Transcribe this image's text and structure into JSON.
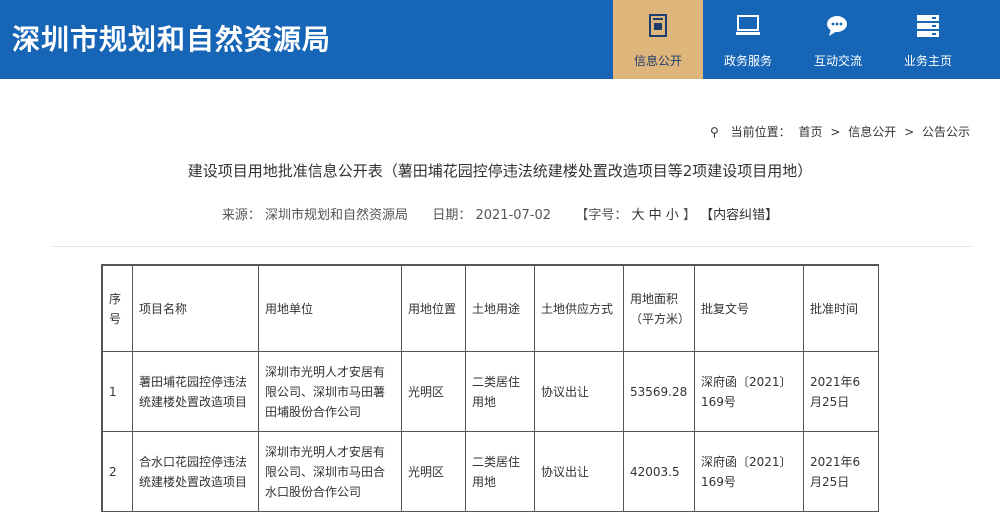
{
  "header": {
    "site_title": "深圳市规划和自然资源局",
    "nav": [
      {
        "label": "信息公开",
        "icon": "document-icon",
        "active": true
      },
      {
        "label": "政务服务",
        "icon": "monitor-icon",
        "active": false
      },
      {
        "label": "互动交流",
        "icon": "chat-bubble-icon",
        "active": false
      },
      {
        "label": "业务主页",
        "icon": "server-icon",
        "active": false
      }
    ]
  },
  "breadcrumb": {
    "prefix": "当前位置：",
    "items": [
      "首页",
      "信息公开",
      "公告公示"
    ],
    "separator": ">"
  },
  "article": {
    "title": "建设项目用地批准信息公开表（薯田埔花园控停违法统建楼处置改造项目等2项建设项目用地）",
    "source_label": "来源：",
    "source": "深圳市规划和自然资源局",
    "date_label": "日期：",
    "date": "2021-07-02",
    "font_size_label": "【字号：",
    "font_large": "大",
    "font_medium": "中",
    "font_small": "小",
    "font_size_end": "】",
    "correction": "【内容纠错】"
  },
  "table": {
    "headers": [
      "序号",
      "项目名称",
      "用地单位",
      "用地位置",
      "土地用途",
      "土地供应方式",
      "用地面积（平方米）",
      "批复文号",
      "批准时间"
    ],
    "rows": [
      [
        "1",
        "薯田埔花园控停违法统建楼处置改造项目",
        "深圳市光明人才安居有限公司、深圳市马田薯田埔股份合作公司",
        "光明区",
        "二类居住用地",
        "协议出让",
        "53569.28",
        "深府函〔2021〕169号",
        "2021年6月25日"
      ],
      [
        "2",
        "合水口花园控停违法统建楼处置改造项目",
        "深圳市光明人才安居有限公司、深圳市马田合水口股份合作公司",
        "光明区",
        "二类居住用地",
        "协议出让",
        "42003.5",
        "深府函〔2021〕169号",
        "2021年6月25日"
      ]
    ]
  },
  "colors": {
    "header_bg": "#1765b6",
    "active_nav_bg": "#deb57a"
  }
}
